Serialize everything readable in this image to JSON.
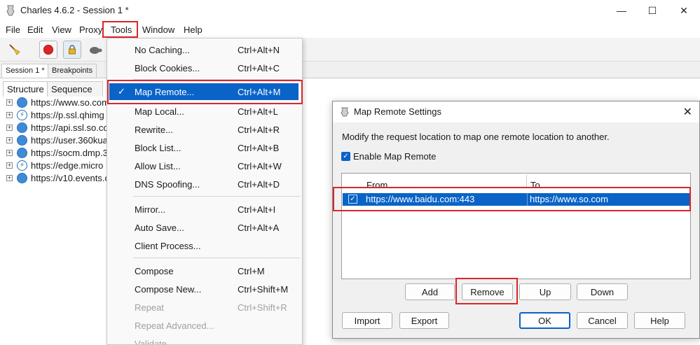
{
  "window": {
    "title": "Charles 4.6.2 - Session 1 *",
    "controls": {
      "minimize": "—",
      "maximize": "☐",
      "close": "✕"
    }
  },
  "menubar": [
    "File",
    "Edit",
    "View",
    "Proxy",
    "Tools",
    "Window",
    "Help"
  ],
  "toolbar": {
    "icons": [
      "broom-icon",
      "record-icon",
      "ssl-lock-icon",
      "throttle-turtle-icon"
    ]
  },
  "session_tabs": [
    "Session 1 *",
    "Breakpoints"
  ],
  "view_tabs": [
    "Structure",
    "Sequence"
  ],
  "tree": [
    {
      "host": "https://www.so.com",
      "icon": "globe-icon"
    },
    {
      "host": "https://p.ssl.qhimg",
      "icon": "bolt-icon"
    },
    {
      "host": "https://api.ssl.so.co",
      "icon": "globe-icon"
    },
    {
      "host": "https://user.360kua",
      "icon": "globe-icon"
    },
    {
      "host": "https://socm.dmp.3",
      "icon": "globe-icon"
    },
    {
      "host": "https://edge.micro",
      "icon": "bolt-icon"
    },
    {
      "host": "https://v10.events.c",
      "icon": "globe-icon"
    }
  ],
  "tools_menu": {
    "items": [
      {
        "label": "No Caching...",
        "shortcut": "Ctrl+Alt+N"
      },
      {
        "label": "Block Cookies...",
        "shortcut": "Ctrl+Alt+C"
      },
      {
        "label": "Map Remote...",
        "shortcut": "Ctrl+Alt+M",
        "checked": "✓"
      },
      {
        "label": "Map Local...",
        "shortcut": "Ctrl+Alt+L"
      },
      {
        "label": "Rewrite...",
        "shortcut": "Ctrl+Alt+R"
      },
      {
        "label": "Block List...",
        "shortcut": "Ctrl+Alt+B"
      },
      {
        "label": "Allow List...",
        "shortcut": "Ctrl+Alt+W"
      },
      {
        "label": "DNS Spoofing...",
        "shortcut": "Ctrl+Alt+D"
      },
      {
        "label": "Mirror...",
        "shortcut": "Ctrl+Alt+I"
      },
      {
        "label": "Auto Save...",
        "shortcut": "Ctrl+Alt+A"
      },
      {
        "label": "Client Process...",
        "shortcut": ""
      },
      {
        "label": "Compose",
        "shortcut": "Ctrl+M"
      },
      {
        "label": "Compose New...",
        "shortcut": "Ctrl+Shift+M"
      },
      {
        "label": "Repeat",
        "shortcut": "Ctrl+Shift+R"
      },
      {
        "label": "Repeat Advanced...",
        "shortcut": ""
      },
      {
        "label": "Validate",
        "shortcut": ""
      }
    ]
  },
  "dialog": {
    "title": "Map Remote Settings",
    "close": "✕",
    "description": "Modify the request location to map one remote location to another.",
    "enable_label": "Enable Map Remote",
    "enable_check": "✓",
    "columns": {
      "from": "From",
      "to": "To"
    },
    "rows": [
      {
        "check": "✓",
        "from": "https://www.baidu.com:443",
        "to": "https://www.so.com"
      }
    ],
    "buttons": {
      "add": "Add",
      "remove": "Remove",
      "up": "Up",
      "down": "Down",
      "import": "Import",
      "export": "Export",
      "ok": "OK",
      "cancel": "Cancel",
      "help": "Help"
    }
  },
  "colors": {
    "selection": "#0a64c8",
    "highlight_box": "#d9262d"
  }
}
